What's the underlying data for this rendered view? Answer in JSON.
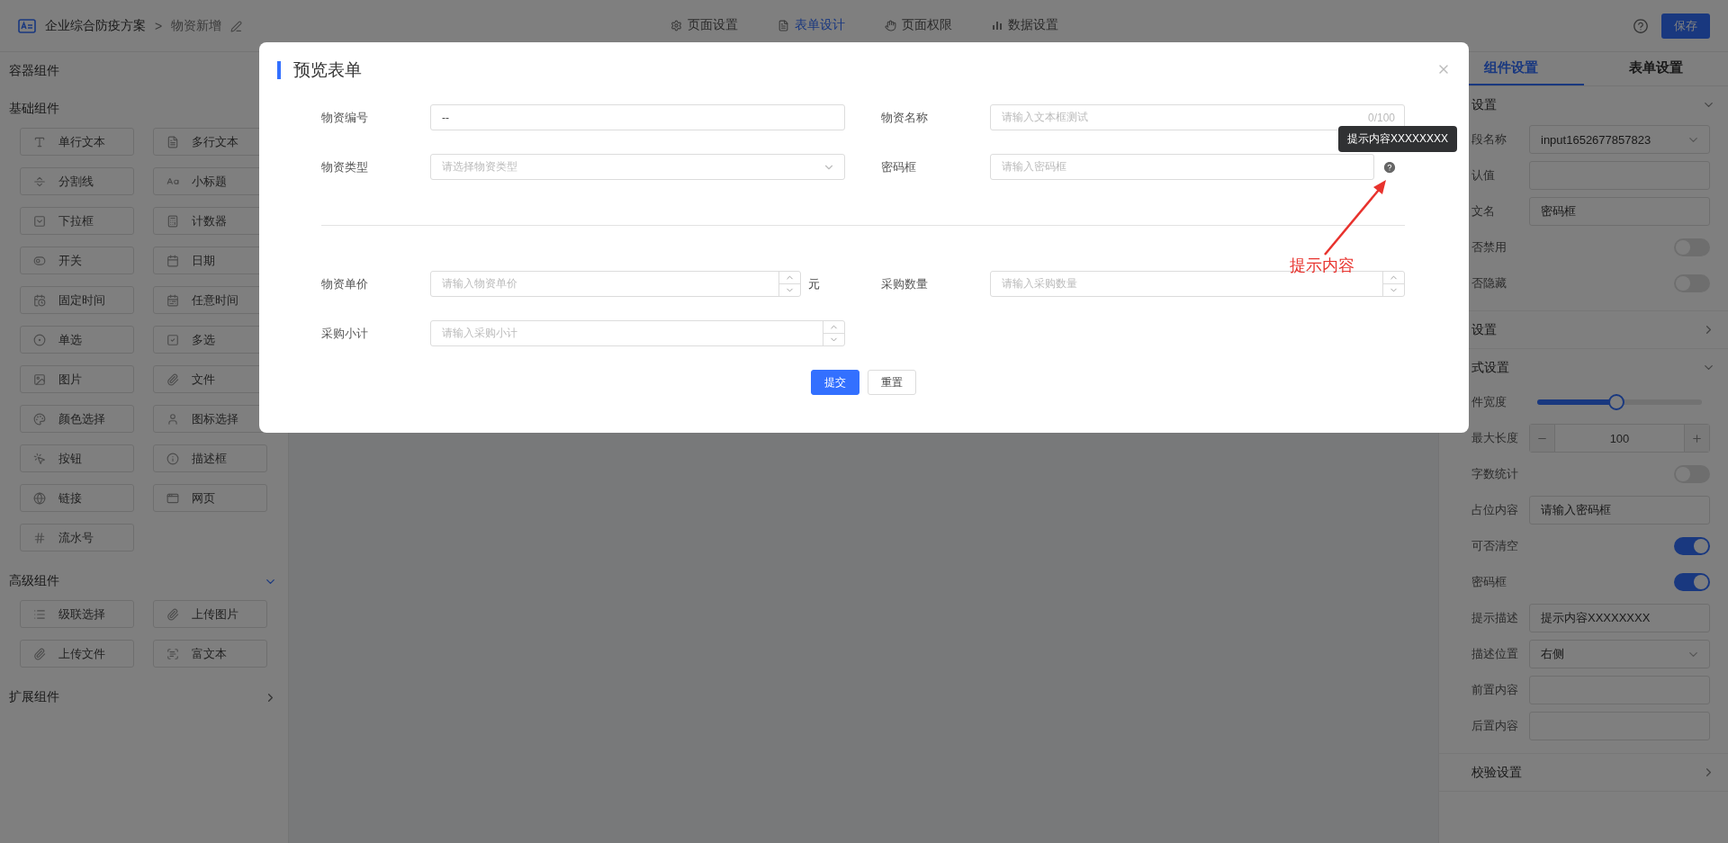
{
  "top_bar": {
    "title": "企业综合防疫方案",
    "separator": ">",
    "page": "物资新增",
    "tabs": [
      {
        "label": "页面设置",
        "selected": false
      },
      {
        "label": "表单设计",
        "selected": true
      },
      {
        "label": "页面权限",
        "selected": false
      },
      {
        "label": "数据设置",
        "selected": false
      }
    ],
    "save_button": "保存"
  },
  "sidebar": {
    "sections": [
      {
        "title": "容器组件"
      },
      {
        "title": "基础组件",
        "items": [
          "单行文本",
          "多行文本",
          "分割线",
          "小标题",
          "下拉框",
          "计数器",
          "开关",
          "日期",
          "固定时间",
          "任意时间",
          "单选",
          "多选",
          "图片",
          "文件",
          "颜色选择",
          "图标选择",
          "按钮",
          "描述框",
          "链接",
          "网页",
          "流水号"
        ]
      },
      {
        "title": "高级组件",
        "expanded": true,
        "items": [
          "级联选择",
          "上传图片",
          "上传文件",
          "富文本"
        ]
      },
      {
        "title": "扩展组件",
        "expanded": false
      }
    ]
  },
  "dialog": {
    "title": "预览表单",
    "rows": [
      [
        {
          "label": "物资编号",
          "kind": "text",
          "value": "--"
        },
        {
          "label": "物资名称",
          "kind": "text",
          "placeholder": "请输入文本框测试",
          "counter": "0/100"
        }
      ],
      [
        {
          "label": "物资类型",
          "kind": "select",
          "placeholder": "请选择物资类型"
        },
        {
          "label": "密码框",
          "kind": "password",
          "placeholder": "请输入密码框",
          "hint": "提示内容XXXXXXXX"
        }
      ],
      [
        {
          "label": "物资单价",
          "kind": "number",
          "placeholder": "请输入物资单价",
          "suffix": "元"
        },
        {
          "label": "采购数量",
          "kind": "number",
          "placeholder": "请输入采购数量"
        }
      ],
      [
        {
          "label": "采购小计",
          "kind": "number",
          "placeholder": "请输入采购小计"
        }
      ]
    ],
    "buttons": [
      {
        "label": "提交",
        "kind": "primary"
      },
      {
        "label": "重置",
        "kind": "default"
      }
    ],
    "annotation": "提示内容"
  },
  "settings_panel": {
    "tabs": [
      {
        "label": "组件设置",
        "selected": true
      },
      {
        "label": "表单设置",
        "selected": false
      }
    ],
    "sections": [
      {
        "title": "设置",
        "expanded": true,
        "rows": [
          {
            "label": "段名称",
            "kind": "select",
            "value": "input1652677857823"
          },
          {
            "label": "认值",
            "kind": "input"
          },
          {
            "label": "文名",
            "kind": "input",
            "value": "密码框"
          },
          {
            "label": "否禁用",
            "kind": "switch",
            "on": false
          },
          {
            "label": "否隐藏",
            "kind": "switch",
            "on": false
          }
        ]
      },
      {
        "title": "设置",
        "expanded": false
      },
      {
        "title": "式设置",
        "expanded": true,
        "rows": [
          {
            "label": "件宽度",
            "kind": "slider",
            "level": 0.48
          },
          {
            "label": "最大长度",
            "kind": "stepper",
            "value": "100"
          },
          {
            "label": "字数统计",
            "kind": "switch",
            "on": false
          },
          {
            "label": "占位内容",
            "kind": "input",
            "value": "请输入密码框"
          },
          {
            "label": "可否清空",
            "kind": "switch",
            "on": true
          },
          {
            "label": "密码框",
            "kind": "switch",
            "on": true
          },
          {
            "label": "提示描述",
            "kind": "input",
            "value": "提示内容XXXXXXXX"
          },
          {
            "label": "描述位置",
            "kind": "select",
            "value": "右侧"
          },
          {
            "label": "前置内容",
            "kind": "input"
          },
          {
            "label": "后置内容",
            "kind": "input"
          }
        ]
      },
      {
        "title": "校验设置",
        "expanded": false
      }
    ]
  }
}
